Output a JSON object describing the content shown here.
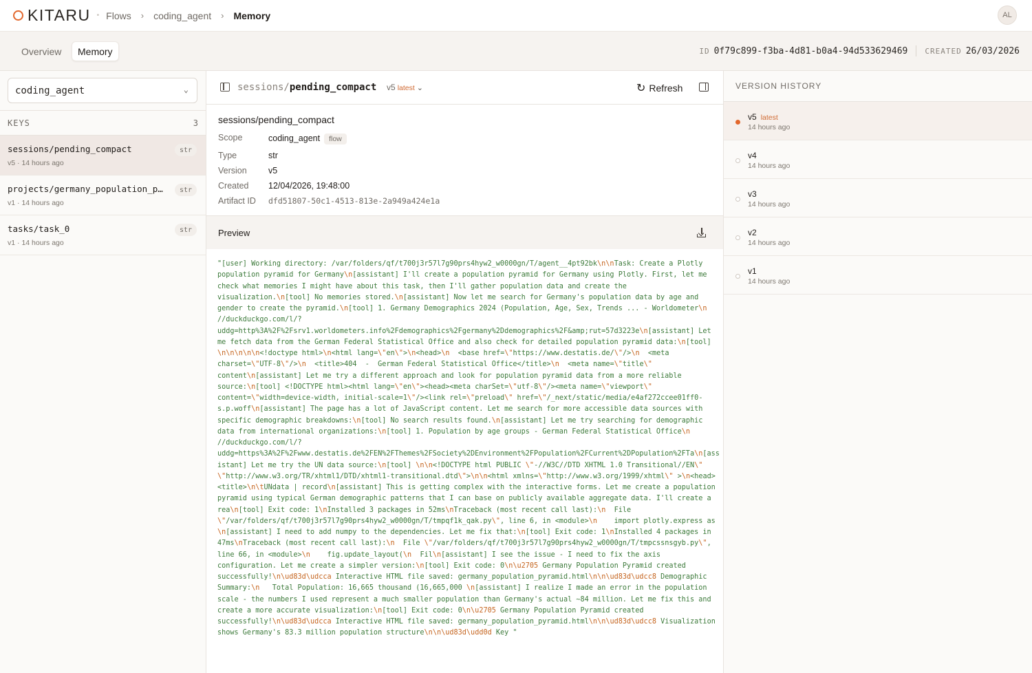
{
  "brand": {
    "name": "KITARU"
  },
  "breadcrumb": {
    "flows": "Flows",
    "flow": "coding_agent",
    "current": "Memory",
    "sep": "›"
  },
  "user": {
    "initials": "AL"
  },
  "tabs": {
    "overview": "Overview",
    "memory": "Memory"
  },
  "meta": {
    "id_label": "ID",
    "id_value": "0f79c899-f3ba-4d81-b0a4-94d533629469",
    "created_label": "CREATED",
    "created_value": "26/03/2026"
  },
  "left": {
    "selected_flow": "coding_agent",
    "keys_label": "KEYS",
    "keys_count": "3",
    "items": [
      {
        "name": "sessions/pending_compact",
        "version": "v5",
        "age": "14 hours ago",
        "type": "str"
      },
      {
        "name": "projects/germany_population_pyramid",
        "version": "v1",
        "age": "14 hours ago",
        "type": "str"
      },
      {
        "name": "tasks/task_0",
        "version": "v1",
        "age": "14 hours ago",
        "type": "str"
      }
    ]
  },
  "center": {
    "path_prefix": "sessions/",
    "path_name": "pending_compact",
    "version": "v5",
    "version_tag": "latest",
    "refresh_label": "Refresh",
    "title": "sessions/pending_compact",
    "details": {
      "scope_label": "Scope",
      "scope_value": "coding_agent",
      "scope_badge": "flow",
      "type_label": "Type",
      "type_value": "str",
      "version_label": "Version",
      "version_value": "v5",
      "created_label": "Created",
      "created_value": "12/04/2026, 19:48:00",
      "artifact_label": "Artifact ID",
      "artifact_value": "dfd51807-50c1-4513-813e-2a949a424e1a"
    },
    "preview_label": "Preview",
    "preview_lines": [
      "\"[user] Working directory: /var/folders/qf/t700j3r57l7g90prs4hyw2_w0000gn/T/agent__4pt92bk\\n\\nTask: Create a Plotly",
      "population pyramid for Germany\\n[assistant] I'll create a population pyramid for Germany using Plotly. First, let me",
      "check what memories I might have about this task, then I'll gather population data and create the",
      "visualization.\\n[tool] No memories stored.\\n[assistant] Now let me search for Germany's population data by age and",
      "gender to create the pyramid.\\n[tool] 1. Germany Demographics 2024 (Population, Age, Sex, Trends ... - Worldometer\\n",
      "//duckduckgo.com/l/?",
      "uddg=http%3A%2F%2Fsrv1.worldometers.info%2Fdemographics%2Fgermany%2Ddemographics%2F&amp;rut=57d3223e\\n[assistant] Let",
      "me fetch data from the German Federal Statistical Office and also check for detailed population pyramid data:\\n[tool]",
      "\\n\\n\\n\\n\\n<!doctype html>\\n<html lang=\\\"en\\\">\\n<head>\\n  <base href=\\\"https://www.destatis.de/\\\"/>\\n  <meta",
      "charset=\\\"UTF-8\\\"/>\\n  <title>404  -  German Federal Statistical Office</title>\\n  <meta name=\\\"title\\\"",
      "content\\n[assistant] Let me try a different approach and look for population pyramid data from a more reliable",
      "source:\\n[tool] <!DOCTYPE html><html lang=\\\"en\\\"><head><meta charSet=\\\"utf-8\\\"/><meta name=\\\"viewport\\\"",
      "content=\\\"width=device-width, initial-scale=1\\\"/><link rel=\\\"preload\\\" href=\\\"/_next/static/media/e4af272ccee01ff0-",
      "s.p.woff\\n[assistant] The page has a lot of JavaScript content. Let me search for more accessible data sources with",
      "specific demographic breakdowns:\\n[tool] No search results found.\\n[assistant] Let me try searching for demographic",
      "data from international organizations:\\n[tool] 1. Population by age groups - German Federal Statistical Office\\n",
      "//duckduckgo.com/l/?",
      "uddg=https%3A%2F%2Fwww.destatis.de%2FEN%2FThemes%2FSociety%2DEnvironment%2FPopulation%2FCurrent%2DPopulation%2FTa\\n[ass",
      "istant] Let me try the UN data source:\\n[tool] \\n\\n<!DOCTYPE html PUBLIC \\\"-//W3C//DTD XHTML 1.0 Transitional//EN\\\"",
      "\\\"http://www.w3.org/TR/xhtml1/DTD/xhtml1-transitional.dtd\\\">\\n\\n<html xmlns=\\\"http://www.w3.org/1999/xhtml\\\" >\\n<head>",
      "<title>\\n\\tUNdata | record\\n[assistant] This is getting complex with the interactive forms. Let me create a population",
      "pyramid using typical German demographic patterns that I can base on publicly available aggregate data. I'll create a",
      "rea\\n[tool] Exit code: 1\\nInstalled 3 packages in 52ms\\nTraceback (most recent call last):\\n  File",
      "\\\"/var/folders/qf/t700j3r57l7g90prs4hyw2_w0000gn/T/tmpqf1k_qak.py\\\", line 6, in <module>\\n    import plotly.express as",
      "\\n[assistant] I need to add numpy to the dependencies. Let me fix that:\\n[tool] Exit code: 1\\nInstalled 4 packages in",
      "47ms\\nTraceback (most recent call last):\\n  File \\\"/var/folders/qf/t700j3r57l7g90prs4hyw2_w0000gn/T/tmpcssnsgyb.py\\\",",
      "line 66, in <module>\\n    fig.update_layout(\\n  Fil\\n[assistant] I see the issue - I need to fix the axis",
      "configuration. Let me create a simpler version:\\n[tool] Exit code: 0\\n\\u2705 Germany Population Pyramid created",
      "successfully!\\n\\ud83d\\udcca Interactive HTML file saved: germany_population_pyramid.html\\n\\n\\ud83d\\udcc8 Demographic",
      "Summary:\\n   Total Population: 16,665 thousand (16,665,000 \\n[assistant] I realize I made an error in the population",
      "scale - the numbers I used represent a much smaller population than Germany's actual ~84 million. Let me fix this and",
      "create a more accurate visualization:\\n[tool] Exit code: 0\\n\\u2705 Germany Population Pyramid created",
      "successfully!\\n\\ud83d\\udcca Interactive HTML file saved: germany_population_pyramid.html\\n\\n\\ud83d\\udcc8 Visualization",
      "shows Germany's 83.3 million population structure\\n\\n\\ud83d\\udd0d Key \""
    ]
  },
  "history": {
    "title": "VERSION HISTORY",
    "items": [
      {
        "version": "v5",
        "tag": "latest",
        "age": "14 hours ago"
      },
      {
        "version": "v4",
        "tag": "",
        "age": "14 hours ago"
      },
      {
        "version": "v3",
        "tag": "",
        "age": "14 hours ago"
      },
      {
        "version": "v2",
        "tag": "",
        "age": "14 hours ago"
      },
      {
        "version": "v1",
        "tag": "",
        "age": "14 hours ago"
      }
    ]
  }
}
